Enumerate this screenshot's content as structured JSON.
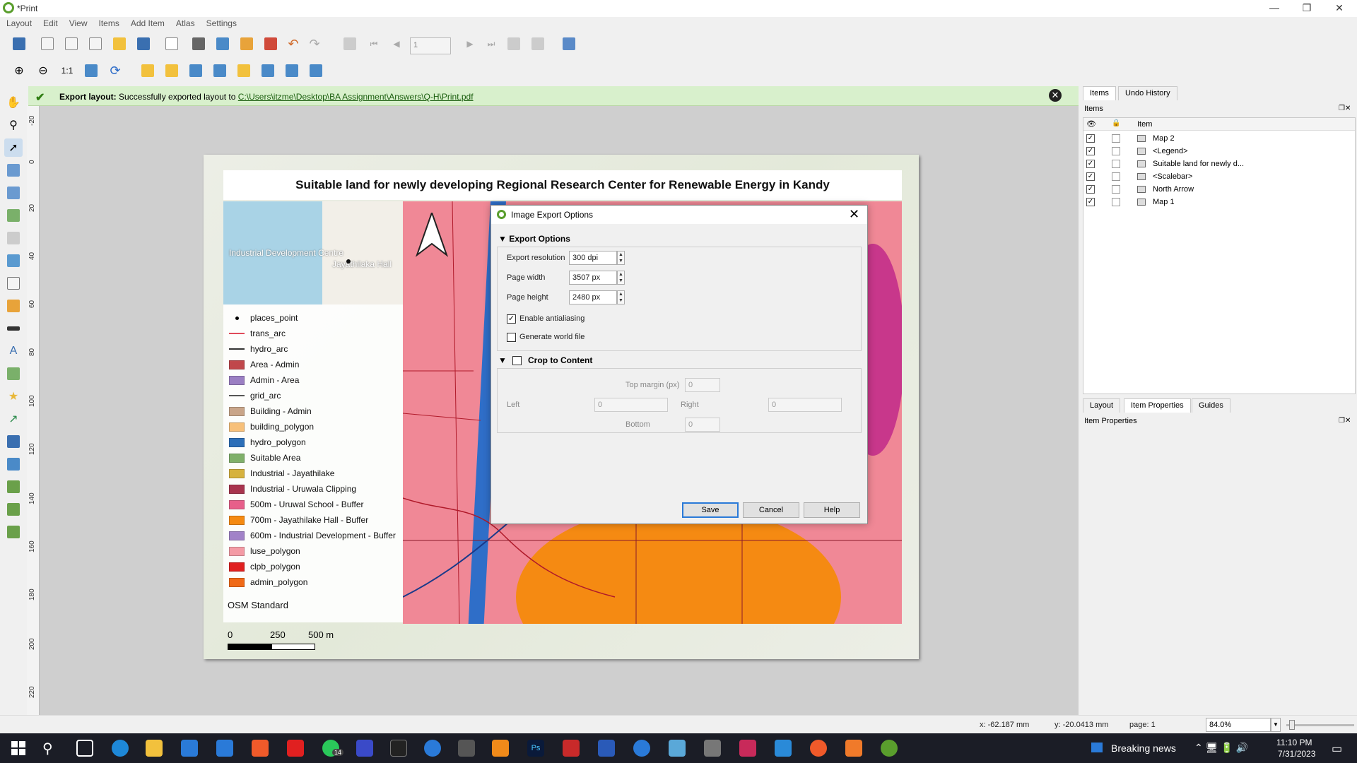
{
  "window": {
    "title": "*Print",
    "minimize": "—",
    "maximize": "❐",
    "close": "✕"
  },
  "menu": [
    "Layout",
    "Edit",
    "View",
    "Items",
    "Add Item",
    "Atlas",
    "Settings"
  ],
  "toolbar": {
    "page_field": "1"
  },
  "message": {
    "label": "Export layout:",
    "text": "Successfully exported layout to",
    "path": "C:\\Users\\itzme\\Desktop\\BA Assignment\\Answers\\Q-H\\Print.pdf"
  },
  "ruler_left": [
    "-20",
    "0",
    "20",
    "40",
    "60",
    "80",
    "100",
    "120",
    "140",
    "160",
    "180",
    "200",
    "220"
  ],
  "layout": {
    "title": "Suitable land for newly developing Regional Research Center for Renewable Energy in Kandy",
    "inset_labels": [
      "Industrial Development Centre",
      "Jayathilaka Hall"
    ],
    "legend": [
      {
        "type": "point",
        "label": "places_point",
        "color": "#000000"
      },
      {
        "type": "line",
        "label": "trans_arc",
        "color": "#e04a5a"
      },
      {
        "type": "line",
        "label": "hydro_arc",
        "color": "#333333"
      },
      {
        "type": "fill",
        "label": "Area - Admin",
        "color": "#c0474b"
      },
      {
        "type": "fill",
        "label": "Admin - Area",
        "color": "#9b7fc3"
      },
      {
        "type": "line",
        "label": "grid_arc",
        "color": "#555555"
      },
      {
        "type": "fill",
        "label": "Building - Admin",
        "color": "#c9a58a"
      },
      {
        "type": "fill",
        "label": "building_polygon",
        "color": "#f7c07a"
      },
      {
        "type": "fill",
        "label": "hydro_polygon",
        "color": "#2c6fb8"
      },
      {
        "type": "fill",
        "label": "Suitable Area",
        "color": "#7fb06a"
      },
      {
        "type": "fill",
        "label": "Industrial - Jayathilake",
        "color": "#d6b23e"
      },
      {
        "type": "fill",
        "label": "Industrial - Uruwala Clipping",
        "color": "#a8344e"
      },
      {
        "type": "fill",
        "label": "500m - Uruwal School - Buffer",
        "color": "#e75f8a"
      },
      {
        "type": "fill",
        "label": "700m - Jayathilake Hall - Buffer",
        "color": "#f58a12"
      },
      {
        "type": "fill",
        "label": "600m - Industrial Development - Buffer",
        "color": "#a182c8"
      },
      {
        "type": "fill",
        "label": "luse_polygon",
        "color": "#f49ba5"
      },
      {
        "type": "fill",
        "label": "clpb_polygon",
        "color": "#e02020"
      },
      {
        "type": "fill",
        "label": "admin_polygon",
        "color": "#f06a18"
      }
    ],
    "basemap": "OSM Standard",
    "scale_labels": [
      "0",
      "250",
      "500 m"
    ]
  },
  "dialog": {
    "title": "Image Export Options",
    "export_options_header": "Export Options",
    "resolution_label": "Export resolution",
    "resolution_value": "300 dpi",
    "width_label": "Page width",
    "width_value": "3507 px",
    "height_label": "Page height",
    "height_value": "2480 px",
    "antialias_label": "Enable antialiasing",
    "antialias_checked": true,
    "worldfile_label": "Generate world file",
    "worldfile_checked": false,
    "crop_header": "Crop to Content",
    "top_margin_label": "Top margin (px)",
    "top_margin_value": "0",
    "left_label": "Left",
    "left_value": "0",
    "right_label": "Right",
    "right_value": "0",
    "bottom_label": "Bottom",
    "bottom_value": "0",
    "save_label": "Save",
    "cancel_label": "Cancel",
    "help_label": "Help"
  },
  "right_panel": {
    "tabs_top": [
      "Items",
      "Undo History"
    ],
    "items_header": "Items",
    "column_item": "Item",
    "items": [
      {
        "name": "Map 2",
        "visible": true
      },
      {
        "name": "<Legend>",
        "visible": true
      },
      {
        "name": "Suitable land for newly d...",
        "visible": true
      },
      {
        "name": "<Scalebar>",
        "visible": true
      },
      {
        "name": "North Arrow",
        "visible": true
      },
      {
        "name": "Map 1",
        "visible": true
      }
    ],
    "tabs_bottom": [
      "Layout",
      "Item Properties",
      "Guides"
    ],
    "props_header": "Item Properties"
  },
  "status": {
    "x": "x: -62.187 mm",
    "y": "y: -20.0413 mm",
    "page": "page: 1",
    "zoom": "84.0%"
  },
  "taskbar": {
    "news": "Breaking news",
    "time": "11:10 PM",
    "date": "7/31/2023",
    "whatsapp_badge": "14"
  }
}
